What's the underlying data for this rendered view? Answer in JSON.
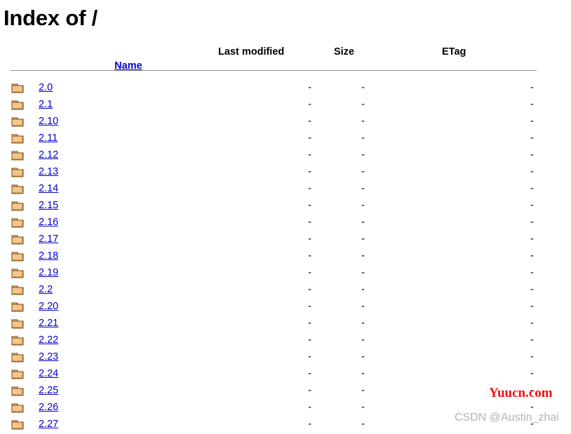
{
  "page": {
    "title": "Index of /"
  },
  "table": {
    "headers": {
      "name": "Name",
      "last_modified": "Last modified",
      "size": "Size",
      "etag": "ETag"
    },
    "placeholder_value": "-",
    "rows": [
      {
        "icon": "folder-icon",
        "name": "2.0",
        "last_modified": "-",
        "size": "-",
        "etag": "-"
      },
      {
        "icon": "folder-icon",
        "name": "2.1",
        "last_modified": "-",
        "size": "-",
        "etag": "-"
      },
      {
        "icon": "folder-icon",
        "name": "2.10",
        "last_modified": "-",
        "size": "-",
        "etag": "-"
      },
      {
        "icon": "folder-icon",
        "name": "2.11",
        "last_modified": "-",
        "size": "-",
        "etag": "-"
      },
      {
        "icon": "folder-icon",
        "name": "2.12",
        "last_modified": "-",
        "size": "-",
        "etag": "-"
      },
      {
        "icon": "folder-icon",
        "name": "2.13",
        "last_modified": "-",
        "size": "-",
        "etag": "-"
      },
      {
        "icon": "folder-icon",
        "name": "2.14",
        "last_modified": "-",
        "size": "-",
        "etag": "-"
      },
      {
        "icon": "folder-icon",
        "name": "2.15",
        "last_modified": "-",
        "size": "-",
        "etag": "-"
      },
      {
        "icon": "folder-icon",
        "name": "2.16",
        "last_modified": "-",
        "size": "-",
        "etag": "-"
      },
      {
        "icon": "folder-icon",
        "name": "2.17",
        "last_modified": "-",
        "size": "-",
        "etag": "-"
      },
      {
        "icon": "folder-icon",
        "name": "2.18",
        "last_modified": "-",
        "size": "-",
        "etag": "-"
      },
      {
        "icon": "folder-icon",
        "name": "2.19",
        "last_modified": "-",
        "size": "-",
        "etag": "-"
      },
      {
        "icon": "folder-icon",
        "name": "2.2",
        "last_modified": "-",
        "size": "-",
        "etag": "-"
      },
      {
        "icon": "folder-icon",
        "name": "2.20",
        "last_modified": "-",
        "size": "-",
        "etag": "-"
      },
      {
        "icon": "folder-icon",
        "name": "2.21",
        "last_modified": "-",
        "size": "-",
        "etag": "-"
      },
      {
        "icon": "folder-icon",
        "name": "2.22",
        "last_modified": "-",
        "size": "-",
        "etag": "-"
      },
      {
        "icon": "folder-icon",
        "name": "2.23",
        "last_modified": "-",
        "size": "-",
        "etag": "-"
      },
      {
        "icon": "folder-icon",
        "name": "2.24",
        "last_modified": "-",
        "size": "-",
        "etag": "-"
      },
      {
        "icon": "folder-icon",
        "name": "2.25",
        "last_modified": "-",
        "size": "-",
        "etag": "-"
      },
      {
        "icon": "folder-icon",
        "name": "2.26",
        "last_modified": "-",
        "size": "-",
        "etag": "-"
      },
      {
        "icon": "folder-icon",
        "name": "2.27",
        "last_modified": "-",
        "size": "-",
        "etag": "-"
      }
    ]
  },
  "watermarks": {
    "yuucn": "Yuucn.com",
    "csdn": "CSDN @Austin_zhai"
  },
  "colors": {
    "link": "#0000cc",
    "text": "#000000",
    "rule": "#9a9a9a",
    "folder_body": "#f5c68c",
    "folder_border": "#7b4a12",
    "watermark_red": "#f01010",
    "watermark_gray": "#b4b4b4",
    "background": "#ffffff"
  }
}
